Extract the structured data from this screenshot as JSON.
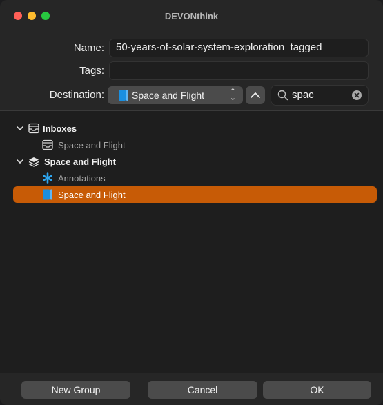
{
  "window": {
    "title": "DEVONthink"
  },
  "form": {
    "name_label": "Name:",
    "name_value": "50-years-of-solar-system-exploration_tagged",
    "tags_label": "Tags:",
    "tags_value": "",
    "destination_label": "Destination:",
    "destination_value": "Space and Flight",
    "search_value": "spac"
  },
  "tree": [
    {
      "label": "Inboxes",
      "icon": "inbox-icon",
      "level": 0,
      "expanded": true
    },
    {
      "label": "Space and Flight",
      "icon": "inbox-icon",
      "level": 1
    },
    {
      "label": "Space and Flight",
      "icon": "database-stack-icon",
      "level": 0,
      "expanded": true
    },
    {
      "label": "Annotations",
      "icon": "asterisk-icon",
      "level": 1
    },
    {
      "label": "Space and Flight",
      "icon": "book-icon",
      "level": 1,
      "selected": true
    }
  ],
  "buttons": {
    "new_group": "New Group",
    "cancel": "Cancel",
    "ok": "OK"
  },
  "colors": {
    "accent": "#c75b06",
    "book_blue": "#1a8fe0",
    "asterisk_blue": "#2ea6f0"
  }
}
